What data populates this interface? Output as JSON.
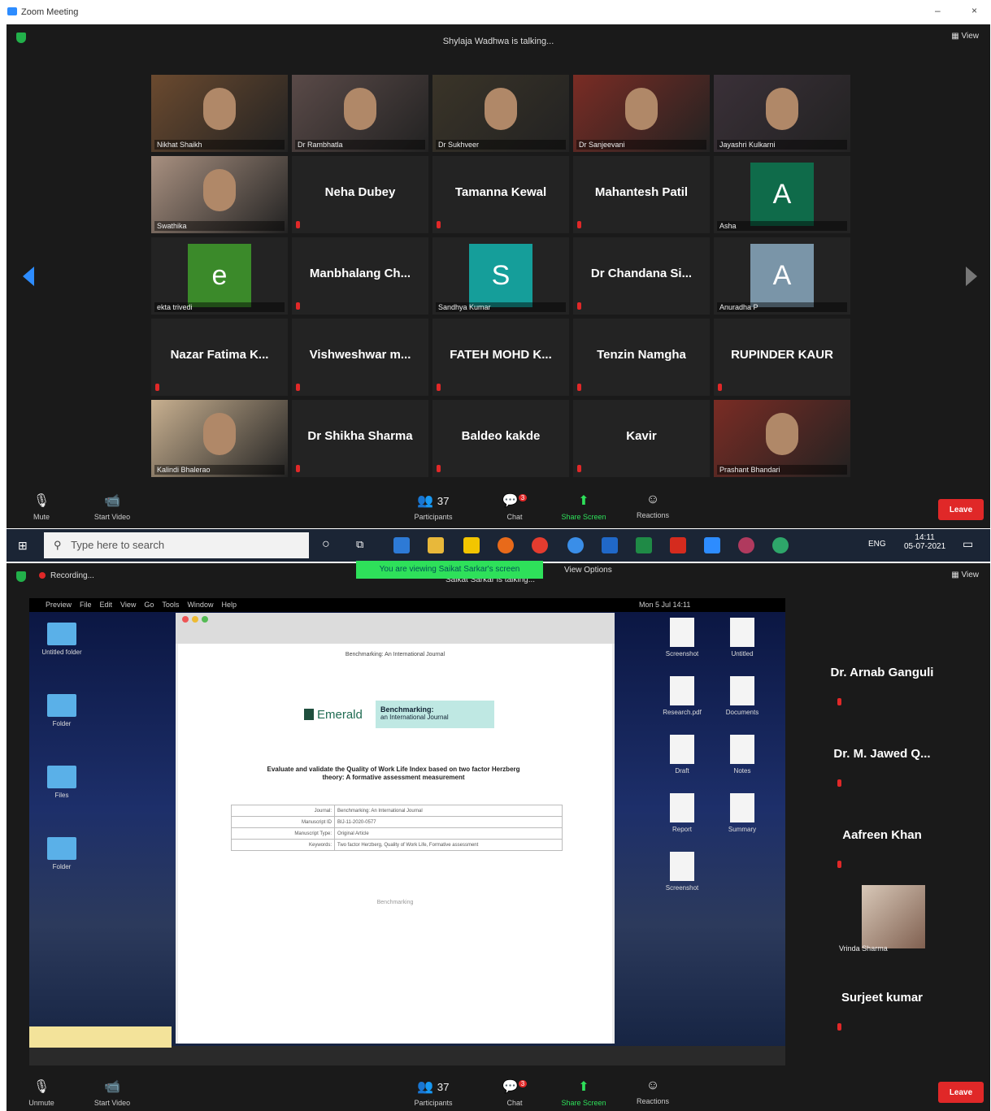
{
  "window": {
    "title": "Zoom Meeting",
    "minimize": "–",
    "close": "×"
  },
  "meeting1": {
    "speaking": "Shylaja Wadhwa is talking...",
    "view_label": "View",
    "participants": [
      {
        "name": "Nikhat Shaikh",
        "kind": "video"
      },
      {
        "name": "Dr Rambhatla",
        "kind": "video"
      },
      {
        "name": "Dr Sukhveer",
        "kind": "video"
      },
      {
        "name": "Dr Sanjeevani",
        "kind": "video"
      },
      {
        "name": "Jayashri Kulkarni",
        "kind": "video"
      },
      {
        "name": "Swathika",
        "kind": "video"
      },
      {
        "name": "Neha Dubey",
        "kind": "name"
      },
      {
        "name": "Tamanna Kewal",
        "kind": "name"
      },
      {
        "name": "Mahantesh Patil",
        "kind": "name"
      },
      {
        "name": "Asha",
        "kind": "avatar",
        "letter": "A",
        "color": "#0f6b4a"
      },
      {
        "name": "ekta trivedi",
        "kind": "avatar",
        "letter": "e",
        "color": "#3b8a2a"
      },
      {
        "name": "Manbhalang Ch...",
        "kind": "name"
      },
      {
        "name": "Sandhya Kumar",
        "kind": "avatar",
        "letter": "S",
        "color": "#159e9a"
      },
      {
        "name": "Dr Chandana Si...",
        "kind": "name"
      },
      {
        "name": "Anuradha P",
        "kind": "avatar",
        "letter": "A",
        "color": "#7a95a8"
      },
      {
        "name": "Nazar Fatima K...",
        "kind": "name"
      },
      {
        "name": "Vishweshwar m...",
        "kind": "name"
      },
      {
        "name": "FATEH MOHD K...",
        "kind": "name"
      },
      {
        "name": "Tenzin Namgha",
        "kind": "name"
      },
      {
        "name": "RUPINDER KAUR",
        "kind": "name"
      },
      {
        "name": "Kalindi Bhalerao",
        "kind": "video"
      },
      {
        "name": "Dr Shikha Sharma",
        "kind": "name"
      },
      {
        "name": "Baldeo kakde",
        "kind": "name"
      },
      {
        "name": "Kavir",
        "kind": "name"
      },
      {
        "name": "Prashant Bhandari",
        "kind": "video"
      }
    ],
    "toolbar": {
      "mute": "Mute",
      "start_video": "Start Video",
      "participants": "Participants",
      "participants_count": "37",
      "chat": "Chat",
      "chat_badge": "3",
      "share_screen": "Share Screen",
      "reactions": "Reactions",
      "leave": "Leave"
    }
  },
  "taskbar": {
    "search_placeholder": "Type here to search",
    "lang": "ENG",
    "time": "14:11",
    "date": "05-07-2021"
  },
  "meeting2": {
    "banner": "You are viewing Saikat Sarkar's screen",
    "view_options": "View Options",
    "speaking": "Saikat Sarkar is talking...",
    "recording": "Recording...",
    "view_label": "View",
    "shared_menu": [
      "Preview",
      "File",
      "Edit",
      "View",
      "Go",
      "Tools",
      "Window",
      "Help"
    ],
    "shared_clock": "Mon 5 Jul 14:11",
    "pdf": {
      "header": "Benchmarking: An International Journal",
      "brand": "Emerald",
      "journal_line1": "Benchmarking:",
      "journal_line2": "an International Journal",
      "title": "Evaluate and validate the Quality of Work Life Index based on two factor Herzberg theory: A formative assessment measurement",
      "rows": [
        {
          "k": "Journal:",
          "v": "Benchmarking: An International Journal"
        },
        {
          "k": "Manuscript ID",
          "v": "BIJ-11-2020-0577"
        },
        {
          "k": "Manuscript Type:",
          "v": "Original Article"
        },
        {
          "k": "Keywords:",
          "v": "Two factor Herzberg, Quality of Work Life, Formative assessment"
        }
      ],
      "footer": "Benchmarking"
    },
    "desktop_left": [
      "Untitled folder",
      "Folder",
      "Files",
      "Folder"
    ],
    "desktop_right": [
      "Screenshot",
      "Untitled",
      "Research.pdf",
      "Documents",
      "Draft",
      "Notes",
      "Report",
      "Summary",
      "Screenshot"
    ],
    "right_panel": [
      {
        "name": "Dr. Arnab Ganguli",
        "kind": "name"
      },
      {
        "name": "Dr. M. Jawed Q...",
        "kind": "name"
      },
      {
        "name": "Aafreen Khan",
        "kind": "name"
      },
      {
        "name": "Vrinda Sharma",
        "kind": "video"
      },
      {
        "name": "Surjeet kumar",
        "kind": "name"
      }
    ],
    "toolbar": {
      "unmute": "Unmute",
      "start_video": "Start Video",
      "participants": "Participants",
      "participants_count": "37",
      "chat": "Chat",
      "chat_badge": "3",
      "share_screen": "Share Screen",
      "reactions": "Reactions",
      "leave": "Leave"
    }
  }
}
